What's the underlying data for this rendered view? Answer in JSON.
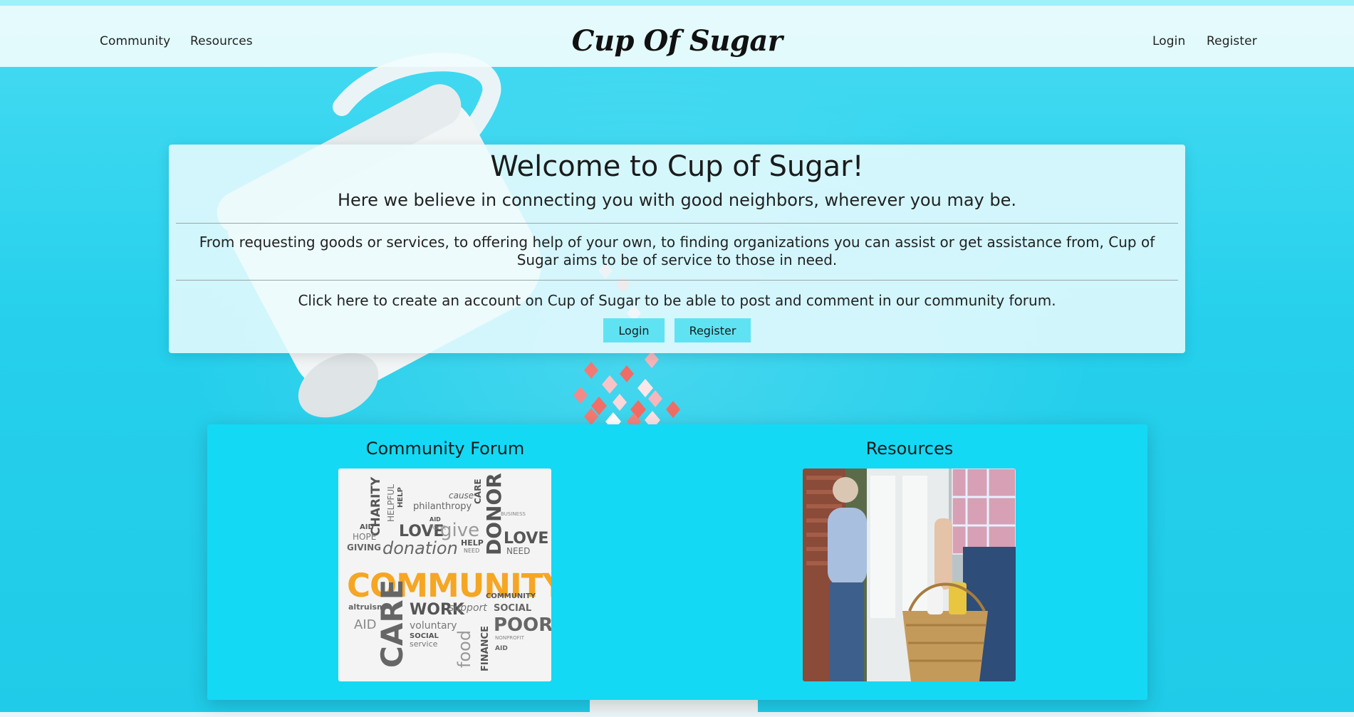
{
  "nav": {
    "left_links": [
      "Community",
      "Resources"
    ],
    "brand": "Cup Of Sugar",
    "right_links": [
      "Login",
      "Register"
    ]
  },
  "welcome": {
    "title": "Welcome to Cup of Sugar!",
    "lead": "Here we believe in connecting you with good neighbors, wherever you may be.",
    "description": "From requesting goods or services, to offering help of your own, to finding organizations you can assist or get assistance from, Cup of Sugar aims to be of service to those in need.",
    "cta": "Click here to create an account on Cup of Sugar to be able to post and comment in our community forum.",
    "login_label": "Login",
    "register_label": "Register"
  },
  "features": {
    "community": {
      "title": "Community Forum",
      "image_words": {
        "main": "COMMUNITY",
        "words": [
          "CHARITY",
          "HELPFUL",
          "HELP",
          "cause",
          "CARE",
          "philanthropy",
          "BUSINESS",
          "AID",
          "HOPE",
          "GIVING",
          "LOVE",
          "AID",
          "POOR",
          "give",
          "donation",
          "HELP",
          "NEED",
          "DONOR",
          "LOVE",
          "NEED",
          "altruism",
          "AID",
          "CARE",
          "WORK",
          "support",
          "COMMUNITY",
          "SOCIAL",
          "voluntary",
          "SOCIAL",
          "service",
          "POOR",
          "food",
          "FINANCE",
          "NONPROFIT",
          "AID"
        ]
      }
    },
    "resources": {
      "title": "Resources"
    }
  },
  "colors": {
    "background": "#26d0ec",
    "nav_background": "#f0fcfd",
    "card_background": "#ecfcfe",
    "button": "#5fe3f3",
    "features_panel": "#14d9f4",
    "community_word": "#f5a623"
  }
}
